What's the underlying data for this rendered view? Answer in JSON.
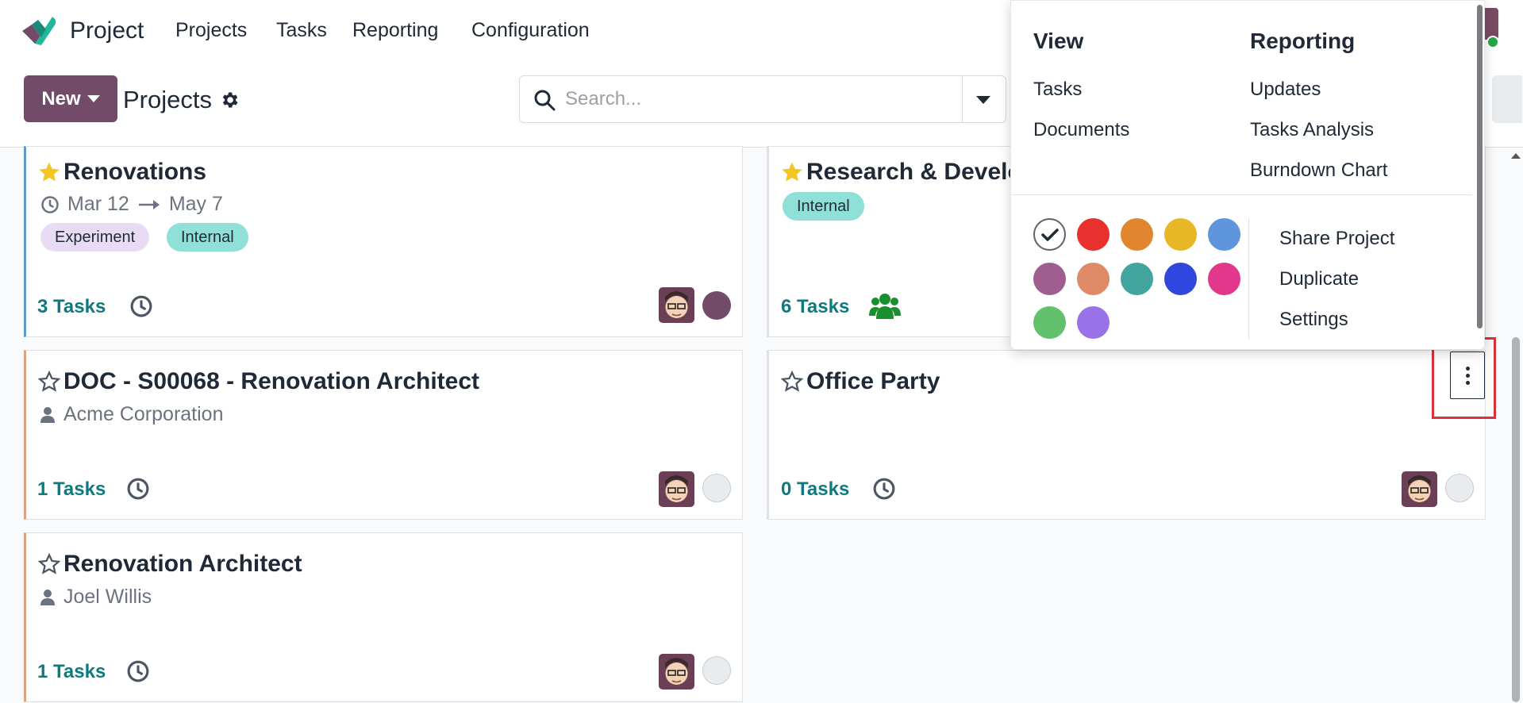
{
  "nav": {
    "app_name": "Project",
    "menu": [
      "Projects",
      "Tasks",
      "Reporting",
      "Configuration"
    ]
  },
  "control": {
    "new_label": "New",
    "breadcrumb": "Projects",
    "search_placeholder": "Search..."
  },
  "cards": [
    {
      "title": "Renovations",
      "starred": true,
      "date_start": "Mar 12",
      "date_end": "May 7",
      "tags": [
        "Experiment",
        "Internal"
      ],
      "tasks_label": "3 Tasks"
    },
    {
      "title": "Research & Develo",
      "starred": true,
      "tags": [
        "Internal"
      ],
      "tasks_label": "6 Tasks"
    },
    {
      "title": "DOC - S00068 - Renovation Architect",
      "starred": false,
      "customer": "Acme Corporation",
      "tasks_label": "1 Tasks"
    },
    {
      "title": "Office Party",
      "starred": false,
      "tasks_label": "0 Tasks"
    },
    {
      "title": "Renovation Architect",
      "starred": false,
      "customer": "Joel Willis",
      "tasks_label": "1 Tasks"
    }
  ],
  "dropdown": {
    "view_heading": "View",
    "view_items": [
      "Tasks",
      "Documents"
    ],
    "reporting_heading": "Reporting",
    "reporting_items": [
      "Updates",
      "Tasks Analysis",
      "Burndown Chart"
    ],
    "actions": [
      "Share Project",
      "Duplicate",
      "Settings"
    ]
  },
  "colors": {
    "brand": "#714b67",
    "tasks_link": "#0e7a7f",
    "swatches": [
      "#ffffff",
      "#e8302f",
      "#e0862f",
      "#e8b725",
      "#5f95dd",
      "#a05d8f",
      "#de8a66",
      "#42a59e",
      "#2f46e0",
      "#e2378a",
      "#62c16d",
      "#9a72e8"
    ]
  }
}
